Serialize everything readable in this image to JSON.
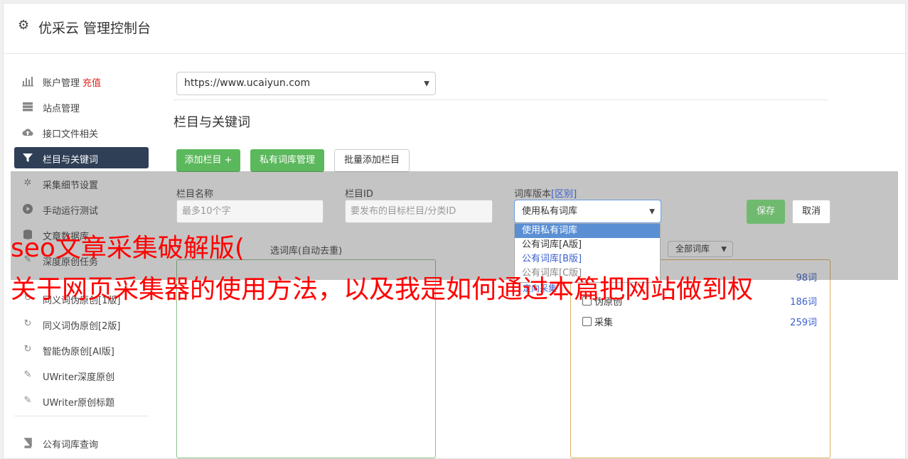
{
  "header": {
    "title": "优采云 管理控制台"
  },
  "sidebar": {
    "items": [
      {
        "label": "账户管理",
        "extra": "充值",
        "icon": "bar-chart-icon"
      },
      {
        "label": "站点管理",
        "icon": "server-icon"
      },
      {
        "label": "接口文件相关",
        "icon": "cloud-upload-icon"
      },
      {
        "label": "栏目与关键词",
        "icon": "filter-icon",
        "active": true
      },
      {
        "label": "采集细节设置",
        "icon": "cogs-icon"
      },
      {
        "label": "手动运行测试",
        "icon": "play-circle-icon"
      },
      {
        "label": "文章数据库",
        "icon": "database-icon"
      },
      {
        "label": "深度原创任务",
        "icon": "edit-icon"
      },
      {
        "label": "同义词伪原创[1版]",
        "icon": "refresh-icon"
      },
      {
        "label": "同义词伪原创[2版]",
        "icon": "refresh-icon"
      },
      {
        "label": "智能伪原创[AI版]",
        "icon": "refresh-icon"
      },
      {
        "label": "UWriter深度原创",
        "icon": "edit-icon"
      },
      {
        "label": "UWriter原创标题",
        "icon": "edit-icon"
      },
      {
        "label": "公有词库查询",
        "icon": "book-icon"
      }
    ]
  },
  "site_select": {
    "value": "https://www.ucaiyun.com"
  },
  "section_title": "栏目与关键词",
  "buttons": {
    "add_column": "添加栏目 +",
    "private_lib": "私有词库管理",
    "batch_add": "批量添加栏目"
  },
  "form": {
    "name_label": "栏目名称",
    "name_placeholder": "最多10个字",
    "id_label": "栏目ID",
    "id_placeholder": "要发布的目标栏目/分类ID",
    "version_label": "词库版本",
    "version_label_link": "[区别]",
    "version_value": "使用私有词库",
    "save": "保存",
    "cancel": "取消"
  },
  "dropdown_options": [
    "使用私有词库",
    "公有词库[A版]",
    "公有词库[B版]",
    "公有词库[C版]"
  ],
  "selected_lib_label": "选词库(自动去重)",
  "right_panel": {
    "filter_value": "全部词库",
    "items": [
      {
        "label": "伪原创",
        "count": "186词"
      },
      {
        "label": "采集",
        "count": "259词"
      }
    ],
    "partial_count": "98词",
    "partial_link": "定向采集"
  },
  "watermark": {
    "line1": "seo文章采集破解版(",
    "line2": "关于网页采集器的使用方法，以及我是如何通过本篇把网站做到权"
  }
}
